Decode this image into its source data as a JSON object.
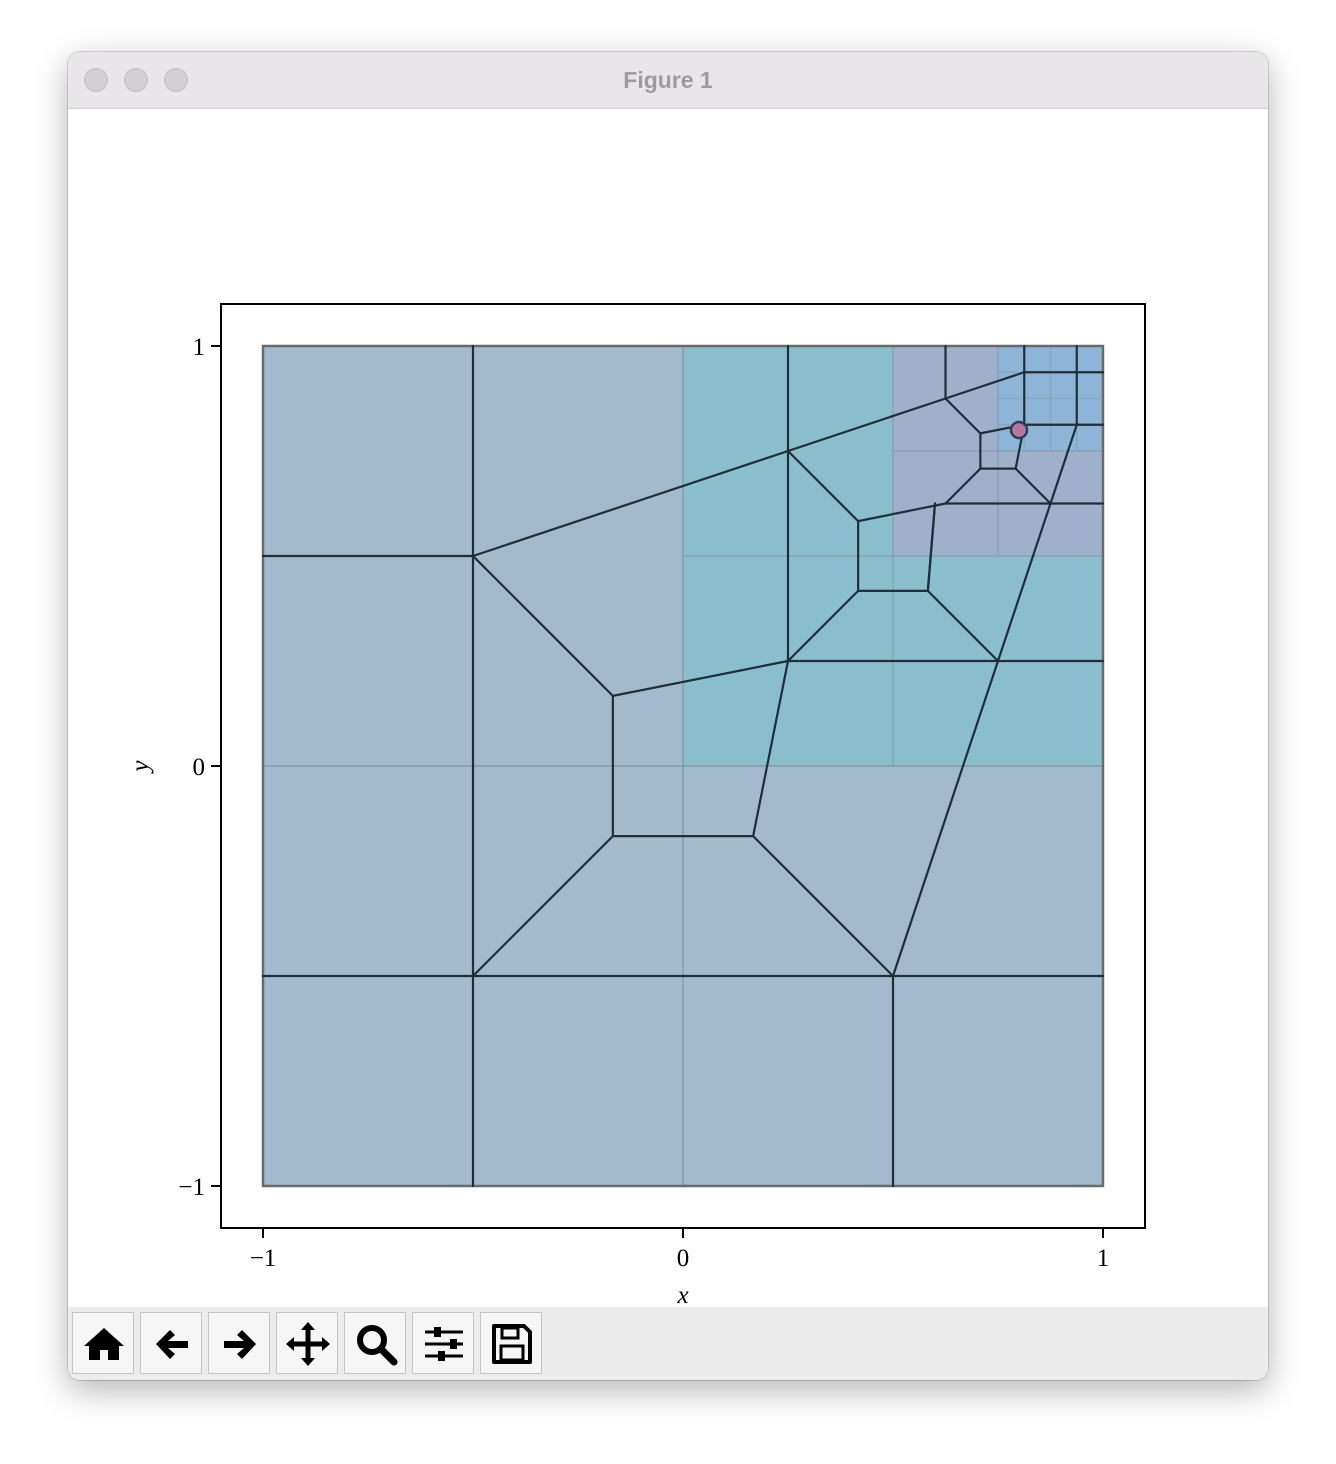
{
  "window": {
    "title": "Figure 1"
  },
  "toolbar": {
    "buttons": [
      {
        "name": "home",
        "icon": "home-icon"
      },
      {
        "name": "back",
        "icon": "arrow-left-icon"
      },
      {
        "name": "forward",
        "icon": "arrow-right-icon"
      },
      {
        "name": "pan",
        "icon": "move-icon"
      },
      {
        "name": "zoom",
        "icon": "magnifier-icon"
      },
      {
        "name": "configure-subplots",
        "icon": "sliders-icon"
      },
      {
        "name": "save",
        "icon": "floppy-disk-icon"
      }
    ]
  },
  "chart_data": {
    "type": "diagram",
    "xlabel": "x",
    "ylabel": "y",
    "xlim": [
      -1.1,
      1.1
    ],
    "ylim": [
      -1.1,
      1.1
    ],
    "xticks": [
      -1,
      0,
      1
    ],
    "yticks": [
      -1,
      0,
      1
    ],
    "xtick_labels": [
      "−1",
      "0",
      "1"
    ],
    "ytick_labels": [
      "−1",
      "0",
      "1"
    ],
    "colors": {
      "level0": "#a1bacd",
      "level1": "#8bbecc",
      "level2": "#9fb0cb",
      "level3": "#8eb4d8",
      "mesh_line": "#1f2e38",
      "point": "#b3789d"
    },
    "refinement_regions": [
      {
        "level": 0,
        "x": [
          -1,
          1
        ],
        "y": [
          -1,
          1
        ]
      },
      {
        "level": 1,
        "x": [
          0,
          1
        ],
        "y": [
          0,
          1
        ]
      },
      {
        "level": 2,
        "x": [
          0.5,
          1
        ],
        "y": [
          0.5,
          1
        ]
      },
      {
        "level": 3,
        "x": [
          0.75,
          1
        ],
        "y": [
          0.75,
          1
        ]
      }
    ],
    "mesh_edges": [
      [
        [
          -1,
          0.5
        ],
        [
          -0.5,
          0.5
        ]
      ],
      [
        [
          -1,
          -0.5
        ],
        [
          -0.5,
          -0.5
        ]
      ],
      [
        [
          -0.5,
          1
        ],
        [
          -0.5,
          0.5
        ]
      ],
      [
        [
          -0.5,
          0.5
        ],
        [
          -0.5,
          -0.5
        ]
      ],
      [
        [
          -0.5,
          -0.5
        ],
        [
          -0.5,
          -1
        ]
      ],
      [
        [
          -0.5,
          -0.5
        ],
        [
          0.5,
          -0.5
        ]
      ],
      [
        [
          0.5,
          -0.5
        ],
        [
          1,
          -0.5
        ]
      ],
      [
        [
          0.5,
          -0.5
        ],
        [
          0.5,
          -1
        ]
      ],
      [
        [
          -0.5,
          0.5
        ],
        [
          0.25,
          0.75
        ]
      ],
      [
        [
          0.25,
          0.75
        ],
        [
          0.625,
          0.875
        ]
      ],
      [
        [
          0.625,
          0.875
        ],
        [
          0.8125,
          0.9375
        ]
      ],
      [
        [
          0.8125,
          0.9375
        ],
        [
          1,
          0.9375
        ]
      ],
      [
        [
          0.8125,
          1
        ],
        [
          0.8125,
          0.9375
        ]
      ],
      [
        [
          0.9375,
          1
        ],
        [
          0.9375,
          0.9375
        ]
      ],
      [
        [
          0.9375,
          0.9375
        ],
        [
          0.9375,
          0.8125
        ]
      ],
      [
        [
          0.8125,
          0.9375
        ],
        [
          0.8125,
          0.8125
        ]
      ],
      [
        [
          0.8125,
          0.8125
        ],
        [
          0.9375,
          0.8125
        ]
      ],
      [
        [
          0.9375,
          0.8125
        ],
        [
          1,
          0.8125
        ]
      ],
      [
        [
          0.9375,
          0.8125
        ],
        [
          0.875,
          0.625
        ]
      ],
      [
        [
          0.875,
          0.625
        ],
        [
          0.75,
          0.25
        ]
      ],
      [
        [
          0.75,
          0.25
        ],
        [
          0.5,
          -0.5
        ]
      ],
      [
        [
          0.25,
          1
        ],
        [
          0.25,
          0.75
        ]
      ],
      [
        [
          0.25,
          0.75
        ],
        [
          0.25,
          0.25
        ]
      ],
      [
        [
          0.625,
          1
        ],
        [
          0.625,
          0.875
        ]
      ],
      [
        [
          -0.5,
          0.5
        ],
        [
          -0.167,
          0.167
        ]
      ],
      [
        [
          -0.167,
          0.167
        ],
        [
          -0.167,
          -0.167
        ]
      ],
      [
        [
          -0.167,
          -0.167
        ],
        [
          0.167,
          -0.167
        ]
      ],
      [
        [
          0.167,
          -0.167
        ],
        [
          0.25,
          0.25
        ]
      ],
      [
        [
          -0.167,
          0.167
        ],
        [
          0.25,
          0.25
        ]
      ],
      [
        [
          -0.167,
          -0.167
        ],
        [
          -0.5,
          -0.5
        ]
      ],
      [
        [
          0.167,
          -0.167
        ],
        [
          0.5,
          -0.5
        ]
      ],
      [
        [
          0.25,
          0.25
        ],
        [
          0.75,
          0.25
        ]
      ],
      [
        [
          0.75,
          0.25
        ],
        [
          1,
          0.25
        ]
      ],
      [
        [
          0.25,
          0.75
        ],
        [
          0.417,
          0.583
        ]
      ],
      [
        [
          0.417,
          0.583
        ],
        [
          0.417,
          0.417
        ]
      ],
      [
        [
          0.417,
          0.417
        ],
        [
          0.583,
          0.417
        ]
      ],
      [
        [
          0.583,
          0.417
        ],
        [
          0.6,
          0.625
        ]
      ],
      [
        [
          0.417,
          0.583
        ],
        [
          0.625,
          0.625
        ]
      ],
      [
        [
          0.417,
          0.417
        ],
        [
          0.25,
          0.25
        ]
      ],
      [
        [
          0.583,
          0.417
        ],
        [
          0.75,
          0.25
        ]
      ],
      [
        [
          0.625,
          0.625
        ],
        [
          0.875,
          0.625
        ]
      ],
      [
        [
          0.875,
          0.625
        ],
        [
          1,
          0.625
        ]
      ],
      [
        [
          0.625,
          0.875
        ],
        [
          0.708,
          0.792
        ]
      ],
      [
        [
          0.708,
          0.792
        ],
        [
          0.708,
          0.708
        ]
      ],
      [
        [
          0.708,
          0.708
        ],
        [
          0.792,
          0.708
        ]
      ],
      [
        [
          0.792,
          0.708
        ],
        [
          0.8125,
          0.8125
        ]
      ],
      [
        [
          0.708,
          0.792
        ],
        [
          0.8125,
          0.8125
        ]
      ],
      [
        [
          0.708,
          0.708
        ],
        [
          0.625,
          0.625
        ]
      ],
      [
        [
          0.792,
          0.708
        ],
        [
          0.875,
          0.625
        ]
      ],
      [
        [
          0.6,
          0.625
        ],
        [
          0.583,
          0.417
        ]
      ]
    ],
    "points": [
      {
        "x": 0.8,
        "y": 0.8
      }
    ]
  }
}
